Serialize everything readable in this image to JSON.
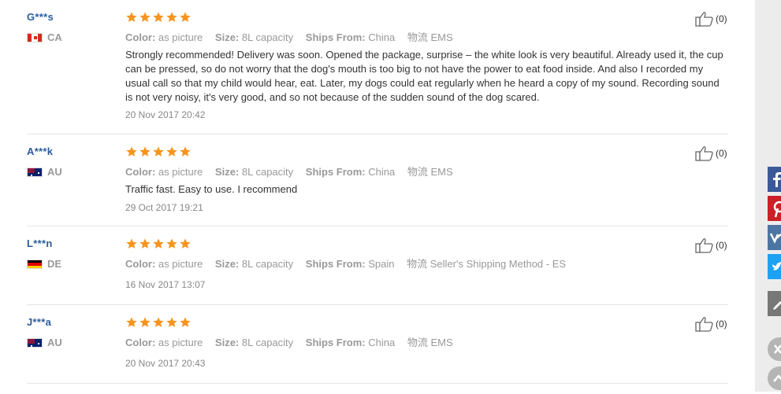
{
  "reviews": [
    {
      "user": "G***s",
      "country": "CA",
      "stars": 5,
      "color_label": "Color:",
      "color_value": "as picture",
      "size_label": "Size:",
      "size_value": "8L capacity",
      "ships_label": "Ships From:",
      "ships_value": "China",
      "logistics_label": "物流",
      "logistics_value": "EMS",
      "content": "Strongly recommended! Delivery was soon. Opened the package, surprise – the white look is very beautiful. Already used it, the cup can be pressed, so do not worry that the dog's mouth is too big to not have the power to eat food inside. And also I recorded my usual call so that my child would hear, eat. Later, my dogs could eat regularly when he heard a copy of my sound. Recording sound is not very noisy, it's very good, and so not because of the sudden sound of the dog scared.",
      "date": "20 Nov 2017 20:42",
      "helpful": "(0)"
    },
    {
      "user": "A***k",
      "country": "AU",
      "stars": 5,
      "color_label": "Color:",
      "color_value": "as picture",
      "size_label": "Size:",
      "size_value": "8L capacity",
      "ships_label": "Ships From:",
      "ships_value": "China",
      "logistics_label": "物流",
      "logistics_value": "EMS",
      "content": "Traffic fast. Easy to use. I recommend",
      "date": "29 Oct 2017 19:21",
      "helpful": "(0)"
    },
    {
      "user": "L***n",
      "country": "DE",
      "stars": 5,
      "color_label": "Color:",
      "color_value": "as picture",
      "size_label": "Size:",
      "size_value": "8L capacity",
      "ships_label": "Ships From:",
      "ships_value": "Spain",
      "logistics_label": "物流",
      "logistics_value": "Seller's Shipping Method - ES",
      "content": "",
      "date": "16 Nov 2017 13:07",
      "helpful": "(0)"
    },
    {
      "user": "J***a",
      "country": "AU",
      "stars": 5,
      "color_label": "Color:",
      "color_value": "as picture",
      "size_label": "Size:",
      "size_value": "8L capacity",
      "ships_label": "Ships From:",
      "ships_value": "China",
      "logistics_label": "物流",
      "logistics_value": "EMS",
      "content": "",
      "date": "20 Nov 2017 20:43",
      "helpful": "(0)"
    }
  ],
  "colors": {
    "star": "#f7941d",
    "username": "#2a5d9c",
    "facebook": "#3b5998",
    "pinterest": "#cb2027",
    "vk": "#4c75a3",
    "twitter": "#1da1f2",
    "edit": "#777777"
  },
  "share": {
    "facebook_icon": "facebook-icon",
    "pinterest_icon": "pinterest-icon",
    "vk_icon": "vk-icon",
    "twitter_icon": "twitter-icon",
    "edit_icon": "pencil-icon",
    "close_icon": "close-icon",
    "up_icon": "chevron-up-icon"
  }
}
